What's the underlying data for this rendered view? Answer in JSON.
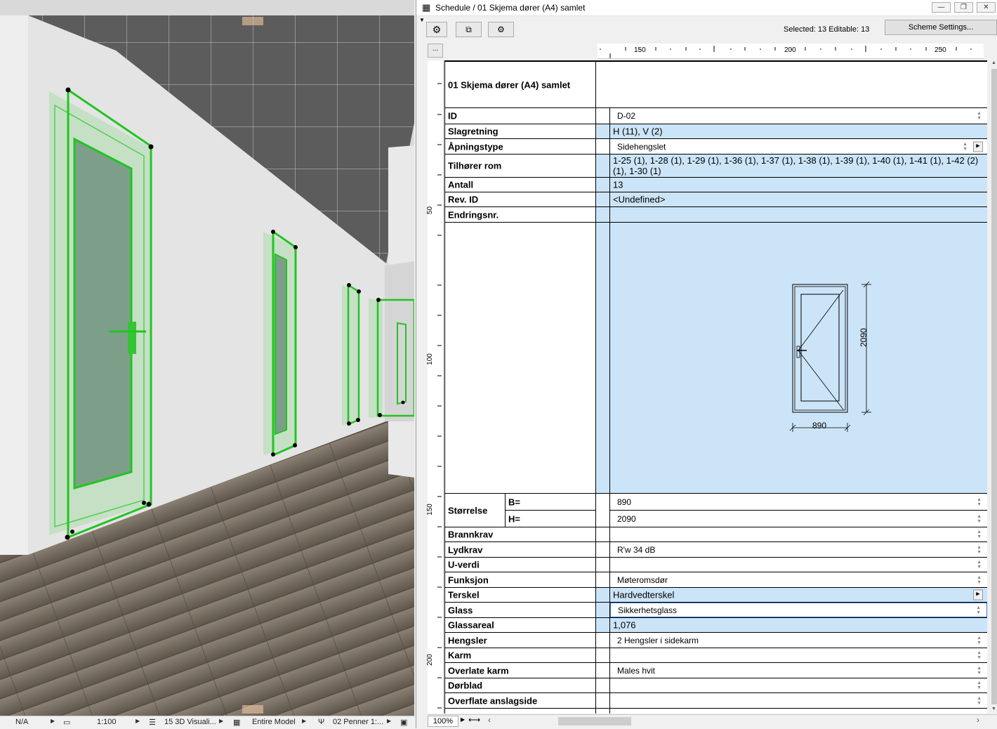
{
  "left_status": {
    "na": "N/A",
    "scale": "1:100",
    "view": "15 3D Visuali...",
    "model": "Entire Model",
    "pens": "02 Penner 1:..."
  },
  "window": {
    "title": "Schedule / 01 Skjema dører (A4) samlet",
    "minimize": "—",
    "restore": "❐",
    "close": "✕"
  },
  "toolbar": {
    "selected_info": "Selected: 13  Editable: 13",
    "scheme_button": "Scheme Settings...",
    "more_button": "..."
  },
  "ruler": {
    "h_ticks": [
      "150",
      "200",
      "250"
    ],
    "v_ticks": [
      "50",
      "100",
      "150",
      "200"
    ]
  },
  "schedule": {
    "header_title": "01 Skjema dører (A4) samlet",
    "rows": {
      "id": {
        "label": "ID",
        "value": "D-02"
      },
      "slagretning": {
        "label": "Slagretning",
        "value": "H (11), V (2)"
      },
      "apningstype": {
        "label": "Åpningstype",
        "value": "Sidehengslet"
      },
      "tilhorer_rom": {
        "label": "Tilhører rom",
        "line1": "1-25 (1), 1-28 (1), 1-29 (1), 1-36 (1), 1-37 (1), 1-38 (1), 1-39 (1), 1-40 (1), 1-41 (1), 1-42 (2)",
        "line2": "(1), 1-30 (1)"
      },
      "antall": {
        "label": "Antall",
        "value": "13"
      },
      "rev_id": {
        "label": "Rev. ID",
        "value": "<Undefined>"
      },
      "endringsnr": {
        "label": "Endringsnr.",
        "value": ""
      },
      "storrelse": {
        "label": "Størrelse",
        "b_label": "B=",
        "b_value": "890",
        "h_label": "H=",
        "h_value": "2090"
      },
      "brannkrav": {
        "label": "Brannkrav",
        "value": ""
      },
      "lydkrav": {
        "label": "Lydkrav",
        "value": "R'w 34 dB"
      },
      "u_verdi": {
        "label": "U-verdi",
        "value": ""
      },
      "funksjon": {
        "label": "Funksjon",
        "value": "Møteromsdør"
      },
      "terskel": {
        "label": "Terskel",
        "value": "Hardvedterskel"
      },
      "glass": {
        "label": "Glass",
        "value": "Sikkerhetsglass"
      },
      "glassareal": {
        "label": "Glassareal",
        "value": "1,076"
      },
      "hengsler": {
        "label": "Hengsler",
        "value": "2 Hengsler i sidekarm"
      },
      "karm": {
        "label": "Karm",
        "value": ""
      },
      "overlate_karm": {
        "label": "Overlate karm",
        "value": "Males hvit"
      },
      "dorblad": {
        "label": "Dørblad",
        "value": ""
      },
      "overflate_anslagside": {
        "label": "Overflate anslagside",
        "value": ""
      }
    },
    "drawing": {
      "width_dim": "890",
      "height_dim": "2090"
    }
  },
  "bottom": {
    "zoom": "100%"
  },
  "colors": {
    "selection_green": "#22c422",
    "value_blue": "#cce4f7",
    "wall": "#e6e6e6",
    "floor": "#6b6155",
    "ceiling": "#5a5a5a"
  }
}
